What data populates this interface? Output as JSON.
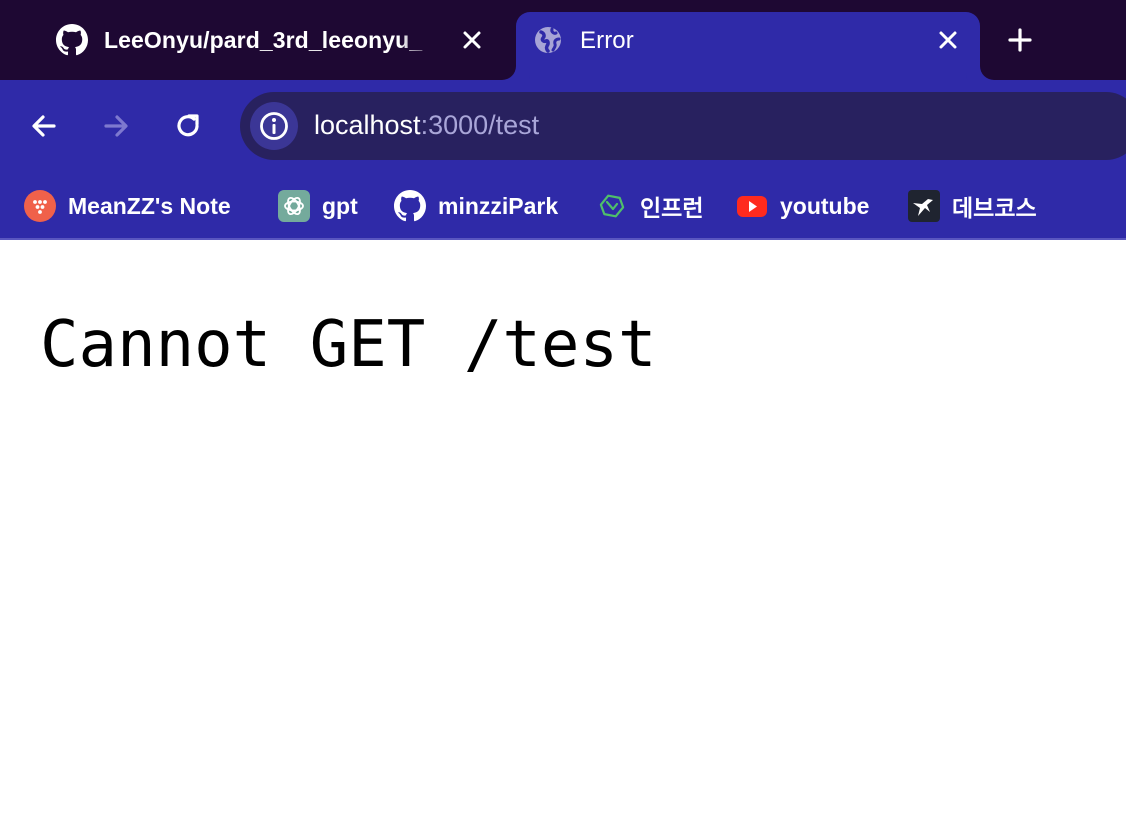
{
  "tabs": [
    {
      "title": "LeeOnyu/pard_3rd_leeonyu_",
      "icon": "github-icon",
      "active": false
    },
    {
      "title": "Error",
      "icon": "globe-icon",
      "active": true
    }
  ],
  "address_bar": {
    "host": "localhost",
    "path": ":3000/test"
  },
  "bookmarks": [
    {
      "label": "MeanZZ's Note",
      "icon": "note-dots-icon"
    },
    {
      "label": "gpt",
      "icon": "openai-icon"
    },
    {
      "label": "minzziPark",
      "icon": "github-icon"
    },
    {
      "label": "인프런",
      "icon": "inflearn-icon"
    },
    {
      "label": "youtube",
      "icon": "youtube-icon"
    },
    {
      "label": "데브코스",
      "icon": "devcourse-icon"
    }
  ],
  "page": {
    "message": "Cannot GET /test"
  },
  "colors": {
    "tabstrip": "#1e0833",
    "toolbar": "#2f2aa8",
    "omnibox": "#28215f"
  }
}
